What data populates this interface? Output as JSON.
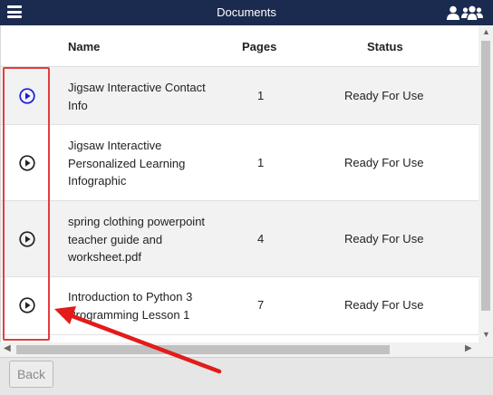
{
  "header": {
    "title": "Documents",
    "menu_icon": "hamburger-menu-icon",
    "user_icon": "user-icon",
    "users_icon": "users-group-icon",
    "background": "#1b2a4f"
  },
  "table": {
    "columns": {
      "name": "Name",
      "pages": "Pages",
      "status": "Status"
    },
    "rows": [
      {
        "name_lines": [
          "Jigsaw Interactive Contact",
          "Info"
        ],
        "pages": "1",
        "status": "Ready For Use",
        "icon": "play-circle-icon",
        "icon_color": "#1a1adf"
      },
      {
        "name_lines": [
          "Jigsaw Interactive",
          "Personalized Learning",
          "Infographic"
        ],
        "pages": "1",
        "status": "Ready For Use",
        "icon": "play-circle-icon",
        "icon_color": "#222222"
      },
      {
        "name_lines": [
          "spring clothing powerpoint",
          "teacher guide and",
          "worksheet.pdf"
        ],
        "pages": "4",
        "status": "Ready For Use",
        "icon": "play-circle-icon",
        "icon_color": "#222222"
      },
      {
        "name_lines": [
          "Introduction to Python 3",
          "Programming Lesson 1"
        ],
        "pages": "7",
        "status": "Ready For Use",
        "icon": "play-circle-icon",
        "icon_color": "#222222"
      }
    ]
  },
  "footer": {
    "back_label": "Back"
  },
  "annotation": {
    "highlight_color": "#e53c3c"
  }
}
